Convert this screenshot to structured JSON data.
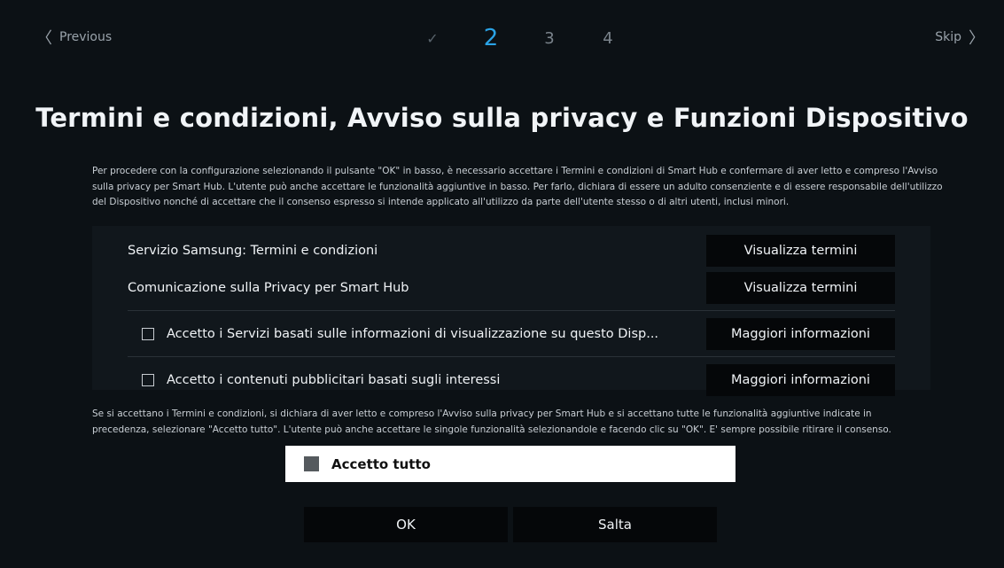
{
  "nav": {
    "previous_label": "Previous",
    "skip_label": "Skip",
    "steps": [
      {
        "label": "✓",
        "state": "done"
      },
      {
        "label": "2",
        "state": "active"
      },
      {
        "label": "3",
        "state": "pending"
      },
      {
        "label": "4",
        "state": "pending"
      }
    ],
    "active_color": "#2aa3e6"
  },
  "title": "Termini e condizioni, Avviso sulla privacy e Funzioni Dispositivo",
  "intro": "Per procedere con la configurazione selezionando il pulsante \"OK\" in basso, è necessario accettare i Termini e condizioni di Smart Hub e confermare di aver letto e compreso l'Avviso sulla privacy per Smart Hub. L'utente può anche accettare le funzionalità aggiuntive in basso. Per farlo, dichiara di essere un adulto consenziente e di essere responsabile dell'utilizzo del Dispositivo nonché di accettare che il consenso espresso si intende applicato all'utilizzo da parte dell'utente stesso o di altri utenti, inclusi minori.",
  "terms": [
    {
      "label": "Servizio Samsung: Termini e condizioni",
      "button": "Visualizza termini"
    },
    {
      "label": "Comunicazione sulla Privacy per Smart Hub",
      "button": "Visualizza termini"
    }
  ],
  "options": [
    {
      "label": "Accetto i Servizi basati sulle informazioni di visualizzazione su questo Disp...",
      "button": "Maggiori informazioni",
      "checked": false
    },
    {
      "label": "Accetto i contenuti pubblicitari basati sugli interessi",
      "button": "Maggiori informazioni",
      "checked": false
    }
  ],
  "disclaimer": "Se si accettano i Termini e condizioni, si dichiara di aver letto e compreso l'Avviso sulla privacy per Smart Hub e si accettano tutte le funzionalità aggiuntive indicate in precedenza, selezionare \"Accetto tutto\". L'utente può anche accettare le singole funzionalità selezionandole e facendo clic su \"OK\". E' sempre possibile ritirare il consenso.",
  "accept_all_label": "Accetto tutto",
  "buttons": {
    "ok": "OK",
    "skip": "Salta"
  }
}
